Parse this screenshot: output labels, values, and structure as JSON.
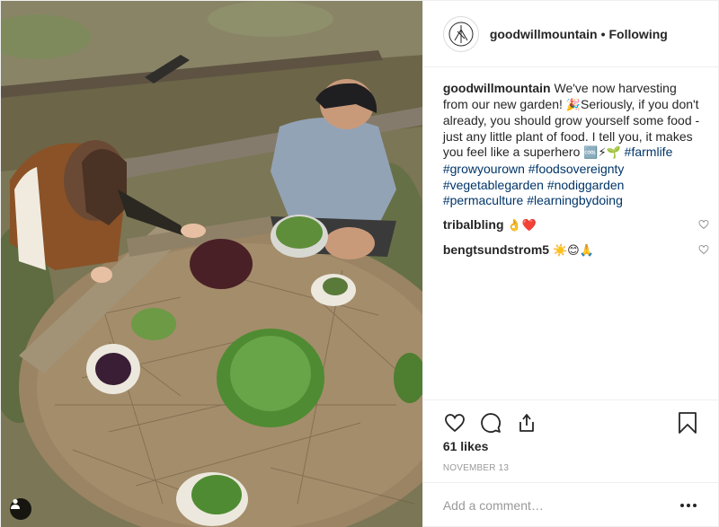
{
  "post": {
    "username": "goodwillmountain",
    "separator": "•",
    "follow_status": "Following",
    "caption": {
      "username": "goodwillmountain",
      "text_1": " We've now harvesting from our new garden! ",
      "emoji_1": "🎉",
      "text_2": "Seriously, if you don't already, you should grow yourself some food - just any little plant of food. I tell you, it makes you feel like a superhero ",
      "emoji_2": "🆒⚡🌱",
      "hashtags": [
        "#farmlife",
        "#growyourown",
        "#foodsovereignty",
        "#vegetablegarden",
        "#nodiggarden",
        "#permaculture",
        "#learningbydoing"
      ]
    },
    "comments": [
      {
        "username": "tribalbling",
        "text": "👌❤️"
      },
      {
        "username": "bengtsundstrom5",
        "text": "☀️😊🙏"
      }
    ],
    "likes": "61 likes",
    "date": "NOVEMBER 13",
    "comment_placeholder": "Add a comment…",
    "icons": {
      "like": "heart-icon",
      "comment": "comment-bubble-icon",
      "share": "share-icon",
      "save": "bookmark-icon",
      "more": "more-options-icon",
      "tagged": "user-tag-icon"
    },
    "colors": {
      "hashtag": "#003569",
      "text": "#262626",
      "muted": "#999999",
      "border": "#efefef"
    }
  }
}
